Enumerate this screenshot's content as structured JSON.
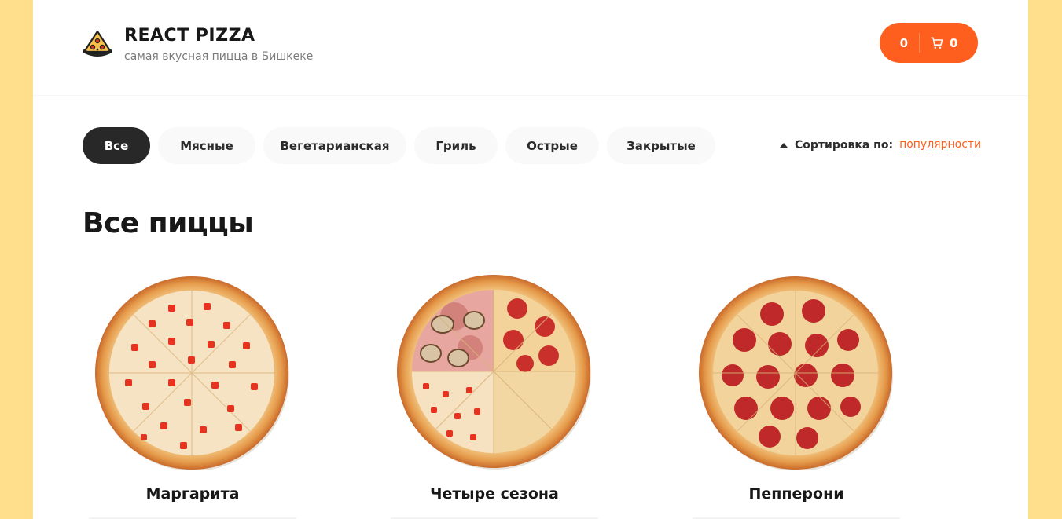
{
  "header": {
    "logo_title": "REACT PIZZA",
    "logo_subtitle": "самая вкусная пицца в Бишкеке",
    "cart": {
      "price": "0",
      "count": "0",
      "icon": "cart-icon"
    }
  },
  "categories": {
    "items": [
      {
        "label": "Все",
        "active": true
      },
      {
        "label": "Мясные",
        "active": false
      },
      {
        "label": "Вегетарианская",
        "active": false
      },
      {
        "label": "Гриль",
        "active": false
      },
      {
        "label": "Острые",
        "active": false
      },
      {
        "label": "Закрытые",
        "active": false
      }
    ]
  },
  "sort": {
    "label": "Сортировка по:",
    "value": "популярности"
  },
  "content": {
    "title": "Все пиццы"
  },
  "pizzas": [
    {
      "name": "Маргарита"
    },
    {
      "name": "Четыре сезона"
    },
    {
      "name": "Пепперони"
    }
  ],
  "colors": {
    "accent": "#fe5f1e",
    "dark": "#282828",
    "page_bg": "#ffdf8c"
  }
}
